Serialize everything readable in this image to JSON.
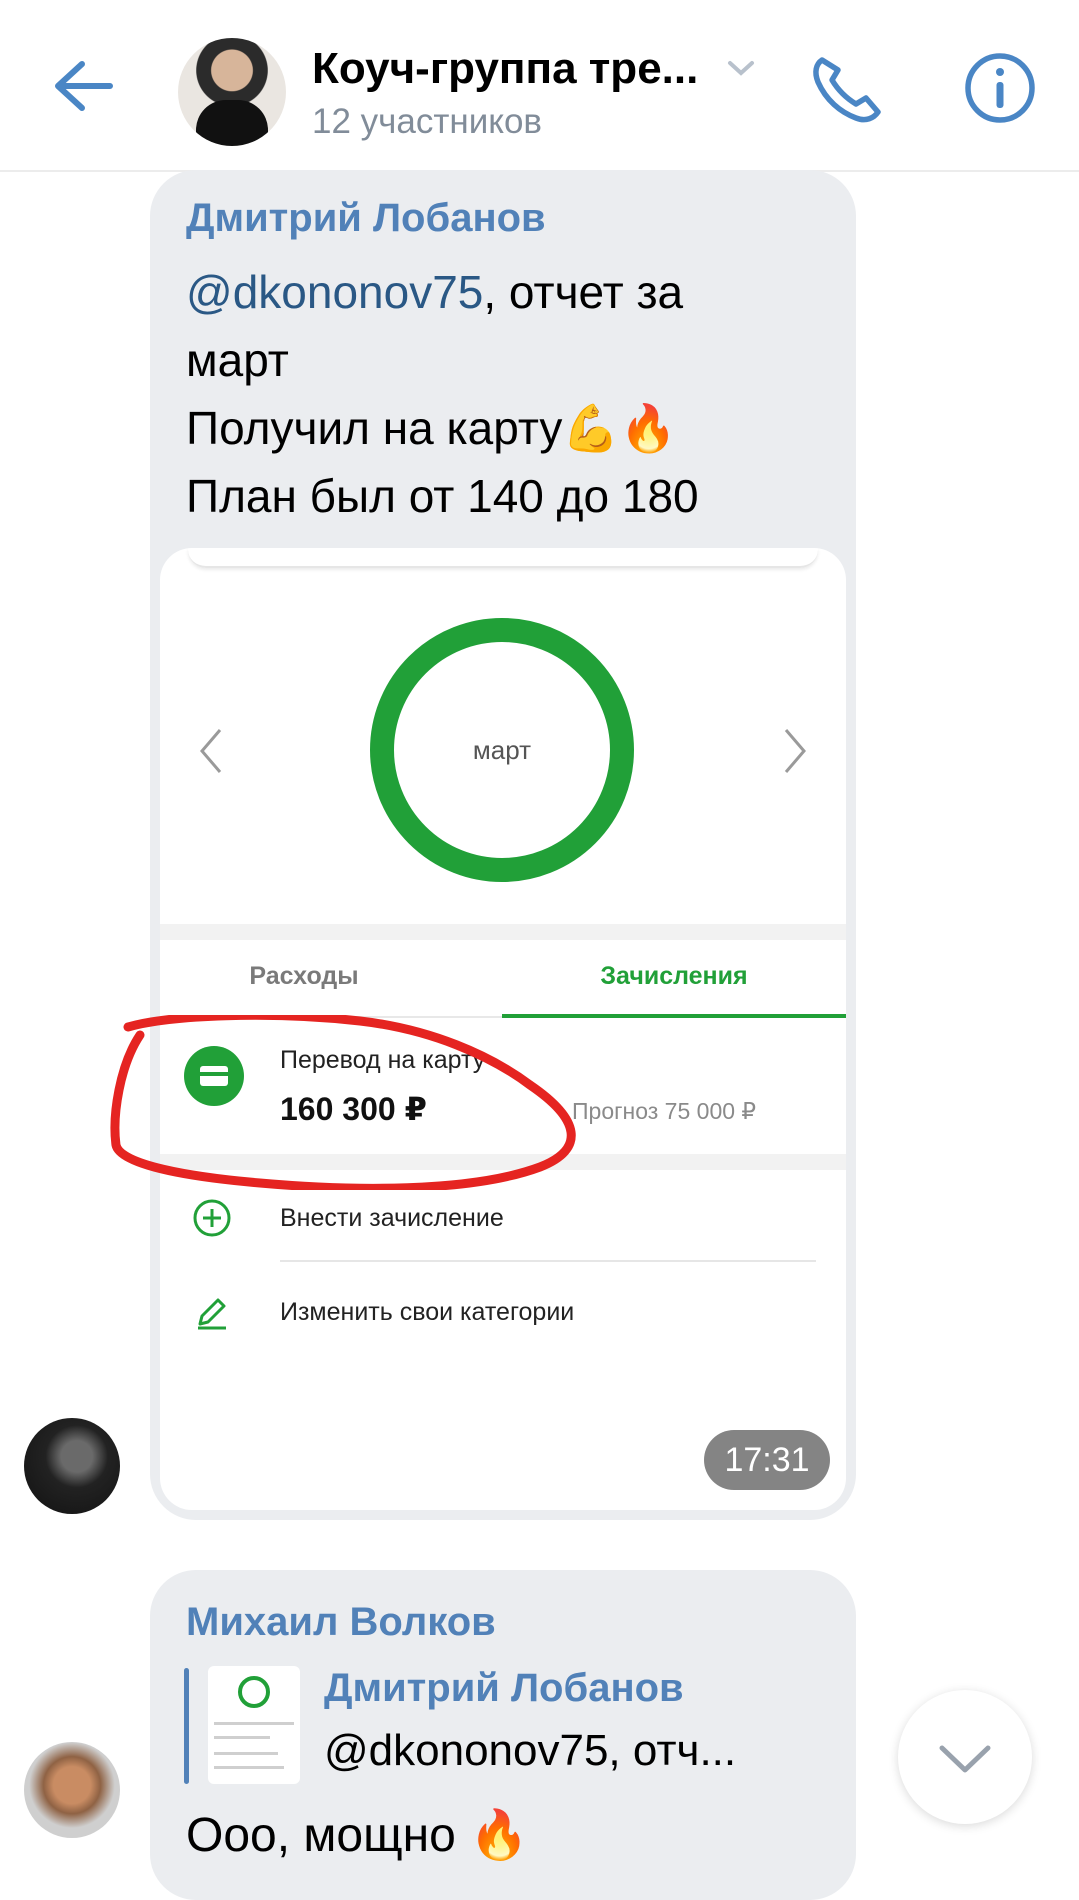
{
  "header": {
    "title": "Коуч-группа тре...",
    "subtitle": "12 участников"
  },
  "message1": {
    "sender": "Дмитрий Лобанов",
    "mention": "@dkononov75",
    "text_after_mention": ", отчет  за",
    "line2": "март",
    "line3": "Получил на карту",
    "line3_emojis": "💪🔥",
    "line4": "План был от 140 до 180",
    "time": "17:31",
    "screenshot": {
      "ring_label": "март",
      "tabs": [
        "Расходы",
        "Зачисления"
      ],
      "active_tab": "Зачисления",
      "transfer_label": "Перевод на карту",
      "transfer_amount": "160 300 ₽",
      "forecast": "Прогноз 75 000 ₽",
      "add_income": "Внести зачисление",
      "edit_categories": "Изменить свои категории",
      "accent_color": "#21a038"
    }
  },
  "message2": {
    "sender": "Михаил Волков",
    "reply_name": "Дмитрий Лобанов",
    "reply_text": "@dkononov75, отч...",
    "text": "Ооо, мощно",
    "emoji": "🔥"
  },
  "colors": {
    "link_blue": "#5181b8",
    "bubble_bg": "#ebedf0",
    "red_marker": "#e52421"
  }
}
